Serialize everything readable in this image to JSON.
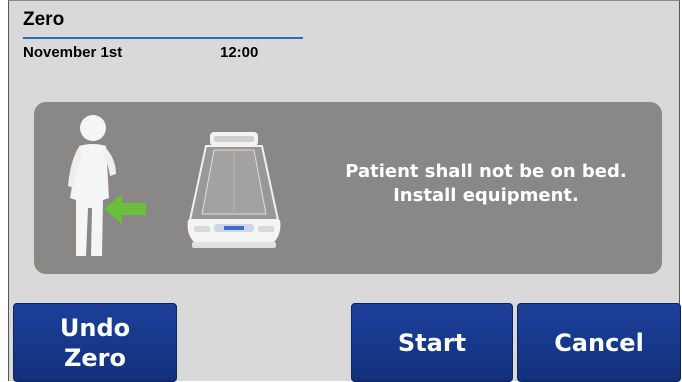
{
  "header": {
    "title": "Zero",
    "date": "November 1st",
    "time": "12:00"
  },
  "panel": {
    "message_line1": "Patient shall not be on bed.",
    "message_line2": "Install equipment.",
    "icons": [
      "person-icon",
      "arrow-left-icon",
      "bed-icon"
    ],
    "colors": {
      "panel": "#8a8886",
      "arrow": "#6bbf3a"
    }
  },
  "buttons": {
    "undo_line1": "Undo",
    "undo_line2": "Zero",
    "start": "Start",
    "cancel": "Cancel",
    "color": "#163789"
  }
}
